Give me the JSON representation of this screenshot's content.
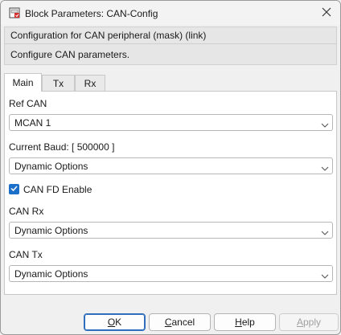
{
  "window": {
    "title": "Block Parameters: CAN-Config",
    "icon": "block-parameters-icon",
    "close_icon": "close-icon"
  },
  "header": {
    "title": "Configuration for CAN peripheral (mask) (link)",
    "description": "Configure CAN parameters."
  },
  "tabs": [
    {
      "label": "Main",
      "active": true
    },
    {
      "label": "Tx",
      "active": false
    },
    {
      "label": "Rx",
      "active": false
    }
  ],
  "fields": {
    "ref_can": {
      "label": "Ref CAN",
      "value": "MCAN 1"
    },
    "current_baud": {
      "label": "Current Baud: [ 500000 ]",
      "value": "Dynamic Options"
    },
    "can_fd_enable": {
      "label": "CAN FD Enable",
      "checked": true
    },
    "can_rx": {
      "label": "CAN Rx",
      "value": "Dynamic Options"
    },
    "can_tx": {
      "label": "CAN Tx",
      "value": "Dynamic Options"
    }
  },
  "buttons": {
    "ok": {
      "prefix": "",
      "accel": "O",
      "suffix": "K"
    },
    "cancel": {
      "prefix": "",
      "accel": "C",
      "suffix": "ancel"
    },
    "help": {
      "prefix": "",
      "accel": "H",
      "suffix": "elp"
    },
    "apply": {
      "prefix": "",
      "accel": "A",
      "suffix": "pply",
      "enabled": false
    }
  },
  "colors": {
    "accent": "#1a6fc9",
    "default_button_border": "#2f6dbd",
    "disabled_text": "#a0a0a0"
  }
}
